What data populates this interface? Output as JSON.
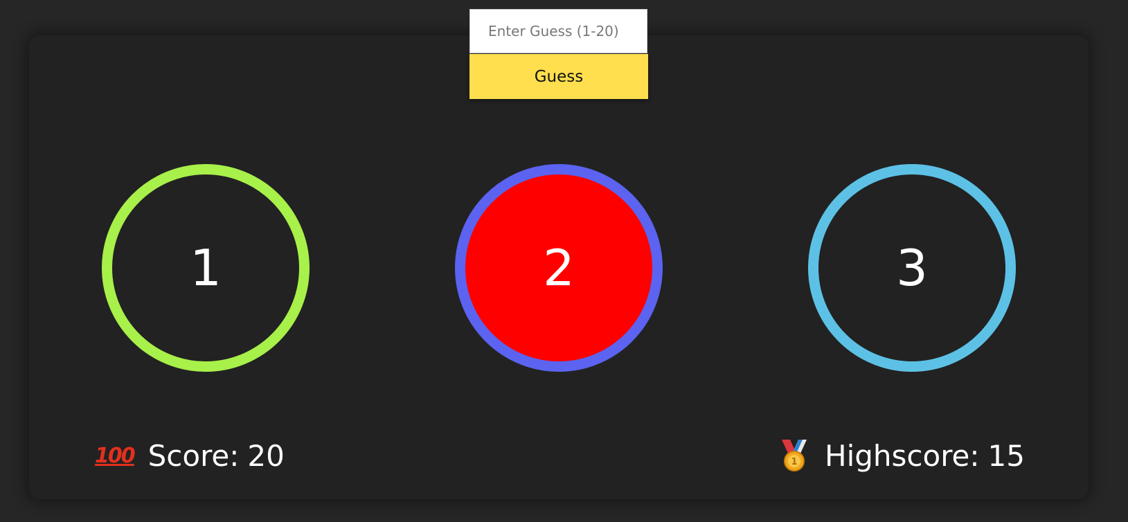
{
  "guess": {
    "placeholder": "Enter Guess (1-20)",
    "button_label": "Guess"
  },
  "circles": [
    {
      "label": "1",
      "border_color": "#a8f04a",
      "fill_color": "transparent"
    },
    {
      "label": "2",
      "border_color": "#5b63f0",
      "fill_color": "#ff0000"
    },
    {
      "label": "3",
      "border_color": "#5dc1e6",
      "fill_color": "transparent"
    }
  ],
  "score": {
    "icon": "hundred-points-icon",
    "label": "Score:",
    "value": "20"
  },
  "highscore": {
    "icon": "medal-icon",
    "label": "Highscore:",
    "value": "15"
  },
  "colors": {
    "page_background": "#262626",
    "card_background": "#222222",
    "button_background": "#ffdf4d"
  }
}
